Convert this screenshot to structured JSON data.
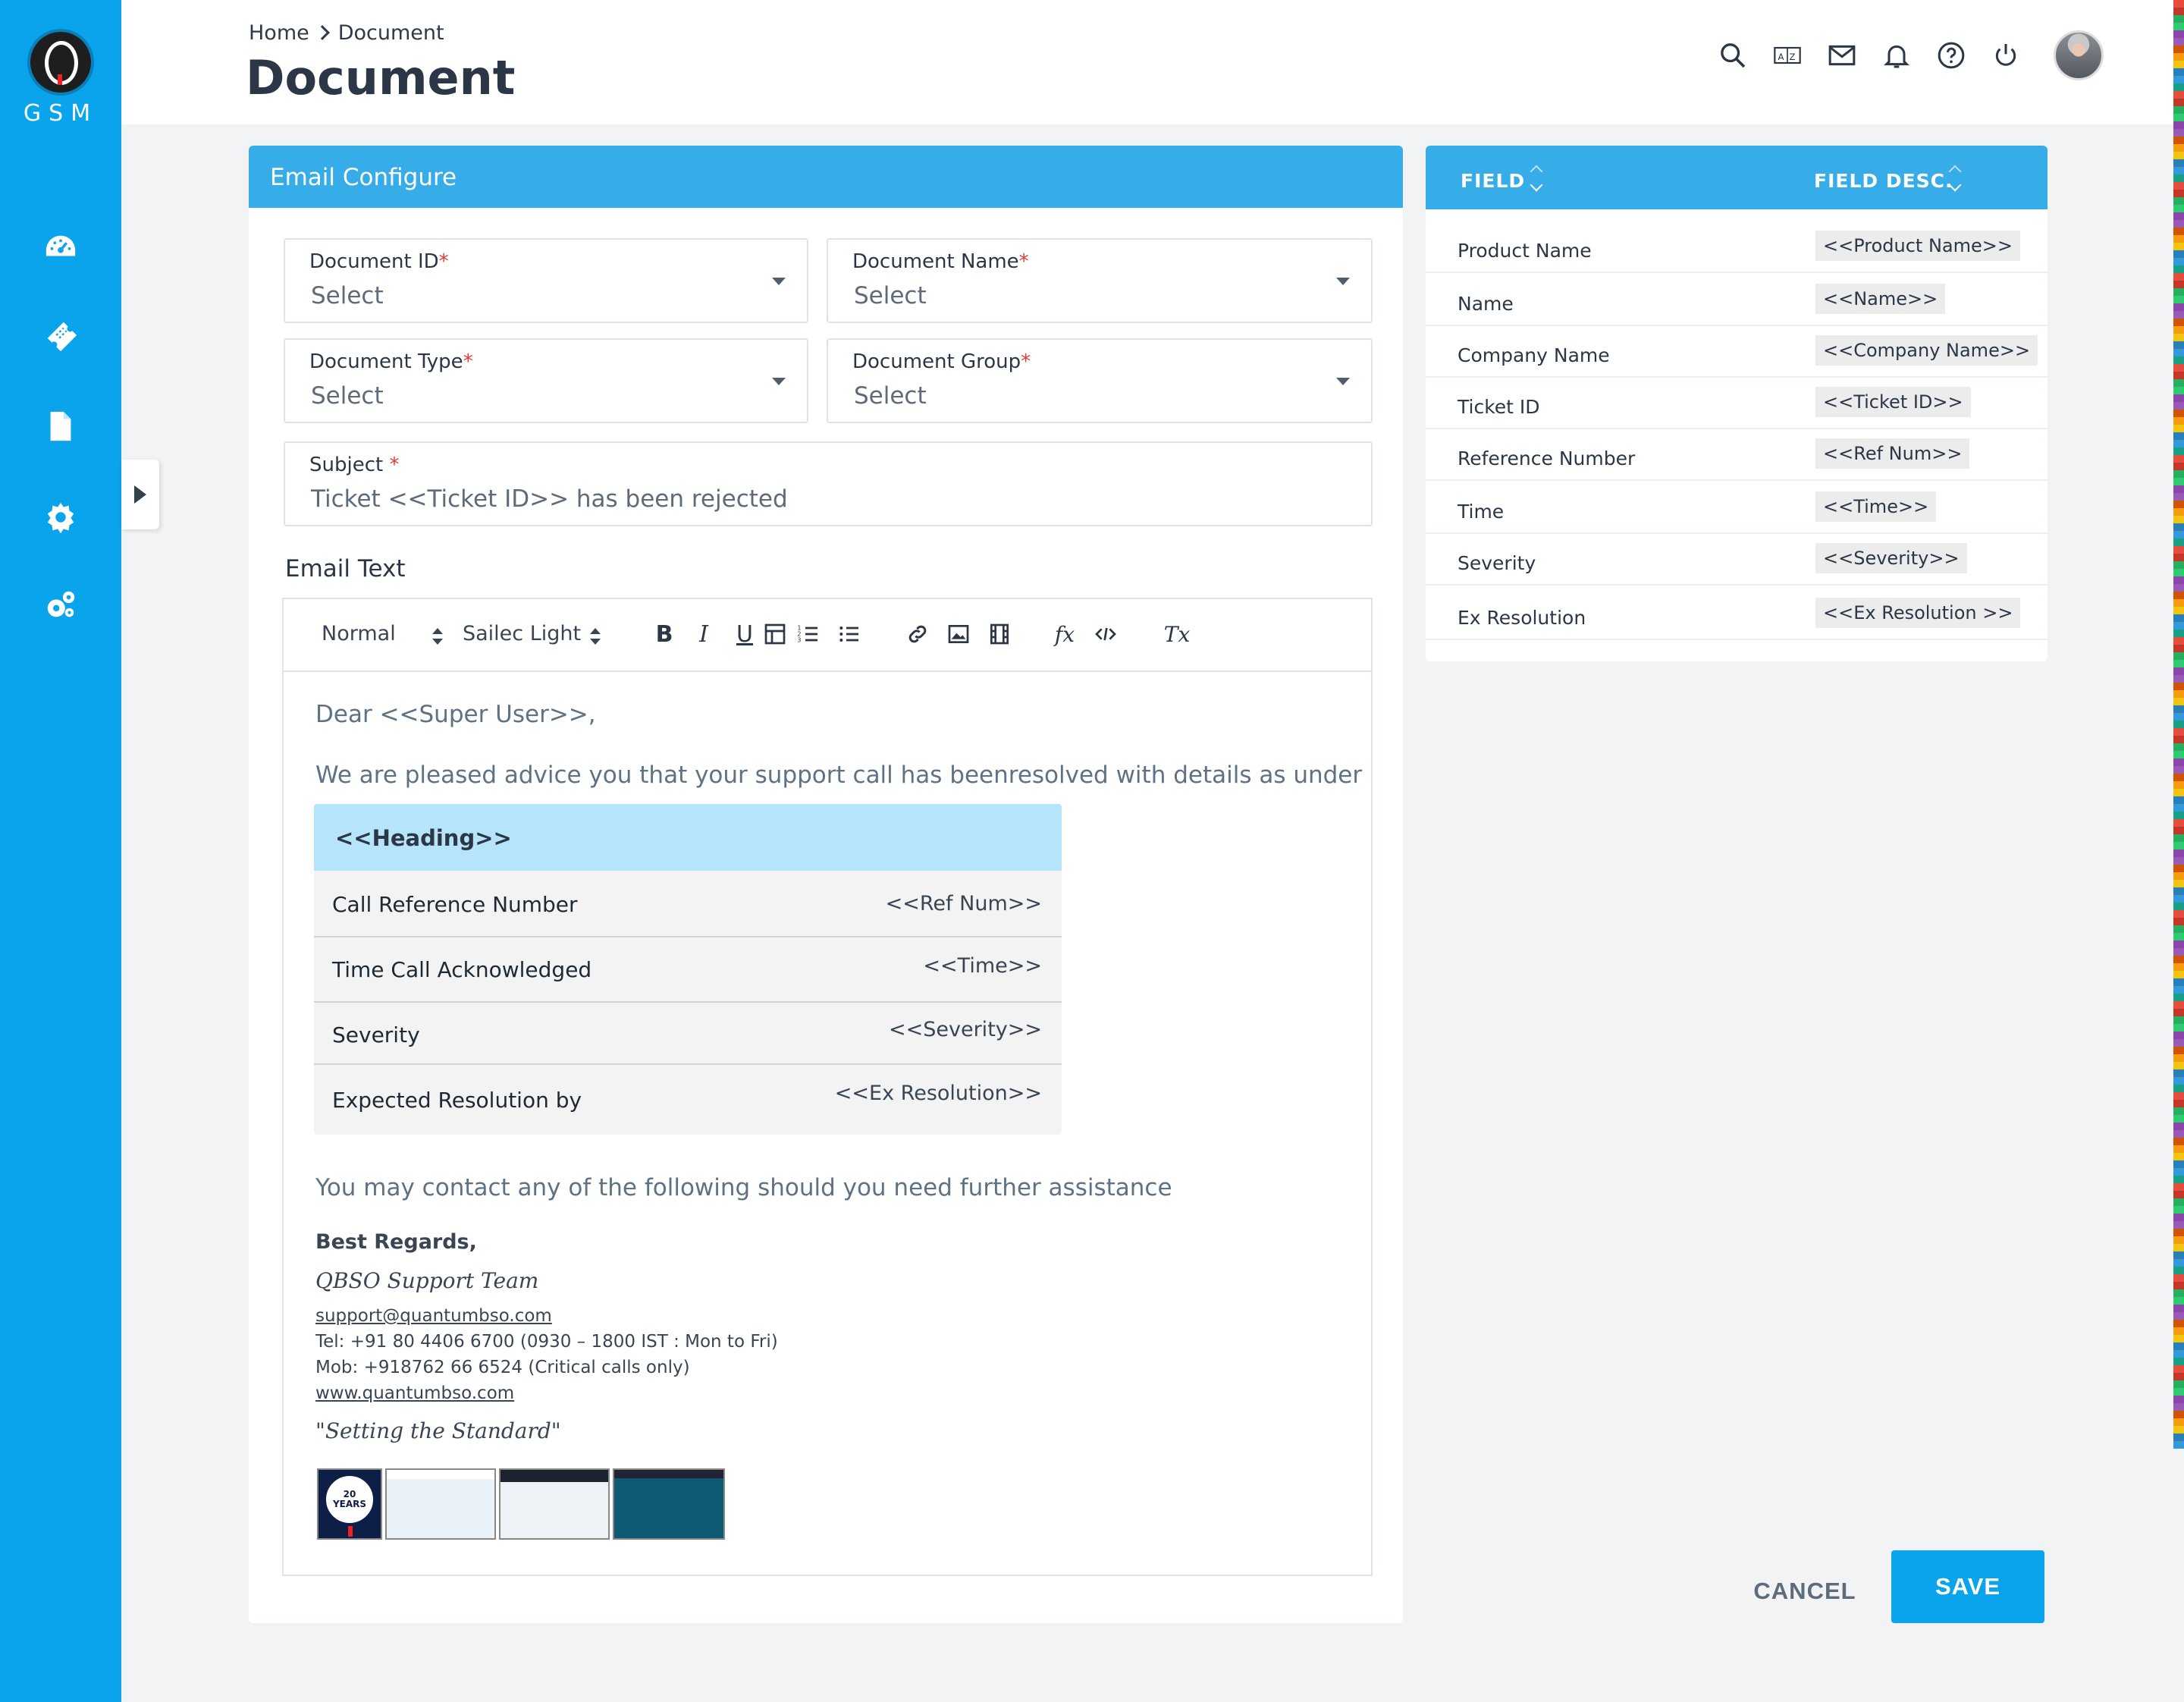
{
  "brand": {
    "logo_text": "GSM"
  },
  "sidebar": {
    "items": [
      {
        "icon": "dashboard-icon"
      },
      {
        "icon": "ticket-icon"
      },
      {
        "icon": "document-icon"
      },
      {
        "icon": "gear-icon"
      },
      {
        "icon": "gears-icon"
      }
    ]
  },
  "header": {
    "breadcrumb": [
      "Home",
      "Document"
    ],
    "title": "Document",
    "icons": [
      "search-icon",
      "translate-icon",
      "mail-icon",
      "bell-icon",
      "help-icon",
      "power-icon"
    ]
  },
  "form": {
    "card_title": "Email Configure",
    "document_id": {
      "label": "Document ID",
      "required": "*",
      "value": "Select"
    },
    "document_name": {
      "label": "Document Name",
      "required": "*",
      "value": "Select"
    },
    "document_type": {
      "label": "Document Type",
      "required": "*",
      "value": "Select"
    },
    "document_group": {
      "label": "Document Group",
      "required": "*",
      "value": "Select"
    },
    "subject": {
      "label": "Subject",
      "required": " *",
      "value": "Ticket <<Ticket ID>> has been rejected"
    },
    "email_text_label": "Email Text"
  },
  "editor": {
    "toolbar": {
      "format": "Normal",
      "font": "Sailec Light",
      "bold": "B",
      "italic": "I",
      "underline": "U",
      "formula": "fx",
      "clear": "Tx"
    },
    "greeting": "Dear <<Super User>>,",
    "intro": "We are pleased advice you that your support call has beenresolved with details as under",
    "table": {
      "heading": "<<Heading>>",
      "rows": [
        {
          "key": "Call Reference Number",
          "value": "<<Ref Num>>"
        },
        {
          "key": "Time Call Acknowledged",
          "value": "<<Time>>"
        },
        {
          "key": "Severity",
          "value": "<<Severity>>"
        },
        {
          "key": "Expected Resolution by",
          "value": "<<Ex Resolution>>"
        }
      ]
    },
    "contact_line": "You may contact any of the following should you need further assistance",
    "regards": "Best Regards,",
    "team": "QBSO Support Team",
    "email": "support@quantumbso.com",
    "tel": "Tel:    +91 80 4406 6700  (0930 – 1800 IST : Mon to Fri)",
    "mob": "Mob: +918762 66 6524 (Critical calls only)",
    "website": "www.quantumbso.com",
    "tagline": "\"Setting the Standard\"",
    "badge_text": "20 YEARS"
  },
  "fields_panel": {
    "col_field": "FIELD",
    "col_desc": "FIELD DESC.",
    "rows": [
      {
        "name": "Product Name",
        "tag": "<<Product Name>>"
      },
      {
        "name": "Name",
        "tag": "<<Name>>"
      },
      {
        "name": "Company Name",
        "tag": "<<Company Name>>"
      },
      {
        "name": "Ticket ID",
        "tag": "<<Ticket ID>>"
      },
      {
        "name": "Reference Number",
        "tag": "<<Ref  Num>>"
      },
      {
        "name": "Time",
        "tag": "<<Time>>"
      },
      {
        "name": "Severity",
        "tag": "<<Severity>>"
      },
      {
        "name": "Ex Resolution",
        "tag": "<<Ex Resolution >>"
      }
    ]
  },
  "actions": {
    "cancel": "CANCEL",
    "save": "SAVE"
  },
  "colors": {
    "sidebar": "#0aa4ec",
    "card_header": "#36ace8",
    "table_heading": "#b5e4fb",
    "required": "#e13a3a"
  }
}
